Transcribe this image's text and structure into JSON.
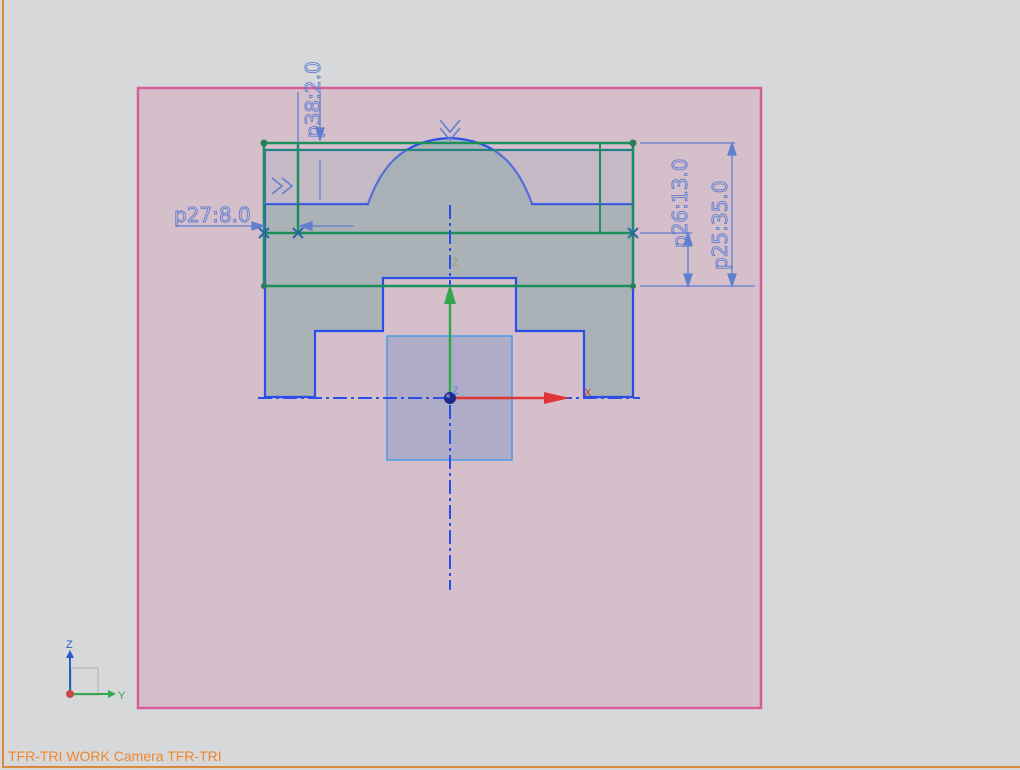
{
  "status_bar": {
    "text": "TFR-TRI WORK Camera TFR-TRI"
  },
  "dimensions": {
    "d38": "p38:2.0",
    "d27": "p27:8.0",
    "d26": "p26:13.0",
    "d25": "p25:35.0"
  },
  "csys": {
    "x_label": "X",
    "y_label": "Y",
    "z_label": "Z"
  },
  "triad": {
    "y_label": "Y",
    "z_label": "Z"
  },
  "colors": {
    "sheet_fill": "#d5bfcb",
    "sheet_border": "#d65c9a",
    "section_fill": "#a5b0b6",
    "outline_blue": "#2b4ee8",
    "constraint_green": "#1a8f5c",
    "dimension_blue": "#5f7fd0",
    "x_axis_red": "#e03535",
    "z_axis_green": "#32a84a",
    "status_orange": "#f0872a"
  }
}
